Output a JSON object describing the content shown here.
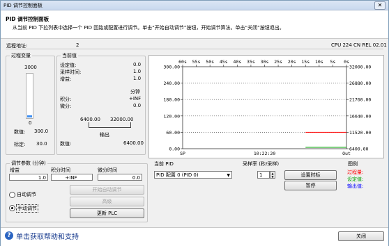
{
  "window": {
    "title": "PID 调节控制面板",
    "close_glyph": "✕"
  },
  "header": {
    "title": "PID 调节控制面板",
    "description": "从当前 PID 下拉列表中选择一个 PID 回路或配置进行调节。单击“开始自动调节”按钮，开始调节算法。单击“关闭”按钮退出。"
  },
  "info_bar": {
    "remote_label": "远程地址:",
    "remote_value": "2",
    "cpu_label": "CPU 224 CN REL 02.01"
  },
  "process_variable": {
    "group_label": "过程变量",
    "scale_top": "3000",
    "scale_bottom": "0",
    "bar_level": 0.05,
    "value_label": "数值:",
    "value": "300.0",
    "setpoint_label": "标定:",
    "setpoint": "30.0"
  },
  "current_values": {
    "group_label": "当前值",
    "rows": [
      {
        "label": "设定值:",
        "value": "0.0"
      },
      {
        "label": "采样时间:",
        "value": "1.0"
      },
      {
        "label": "增益:",
        "value": "1.0"
      }
    ],
    "minutes_label": "分钟",
    "integral_label": "积分:",
    "integral_value": "+INF",
    "derivative_label": "微分:",
    "derivative_value": "0.0",
    "output_min": "6400.00",
    "output_max": "32000.00",
    "output_label": "输出",
    "output_value_label": "数值:",
    "output_value": "6400.00"
  },
  "chart_data": {
    "type": "line",
    "x_ticks": [
      "60s",
      "55s",
      "50s",
      "45s",
      "40s",
      "35s",
      "30s",
      "25s",
      "20s",
      "15s",
      "10s",
      "5s",
      "0s"
    ],
    "left_ticks": [
      "300.00",
      "240.00",
      "180.00",
      "120.00",
      "60.00",
      "0.00"
    ],
    "right_ticks": [
      "32000.00",
      "26880.00",
      "21760.00",
      "16640.00",
      "11520.00",
      "6400.00"
    ],
    "bottom_left_label": "SP",
    "bottom_center_label": "10:22:20",
    "bottom_right_label": "Out",
    "left_range": [
      0,
      300
    ],
    "right_range": [
      6400,
      32000
    ],
    "grid": true,
    "series": [
      {
        "name": "过程量",
        "color": "#ff0000",
        "x": [
          15,
          0
        ],
        "y": [
          60,
          60
        ]
      },
      {
        "name": "输出值",
        "color": "#00a000",
        "x": [
          15,
          0
        ],
        "y": [
          0,
          0
        ]
      }
    ]
  },
  "tuning": {
    "group_label": "调节参数 (分钟)",
    "gain_label": "增益",
    "gain_value": "1.0",
    "integral_label": "积分时间",
    "integral_value": "+INF",
    "derivative_label": "微分时间",
    "derivative_value": "0.0",
    "auto_label": "自动调节",
    "manual_label": "手动调节",
    "start_auto_button": "开始自动调节",
    "advanced_button": "高级",
    "update_button": "更新 PLC"
  },
  "current_pid": {
    "label": "当前 PID",
    "selected": "PID 配置 0 (PID 0)"
  },
  "sample_rate": {
    "label": "采样率 (秒/采样)",
    "value": "1",
    "set_button": "设置时标",
    "pause_button": "暂停"
  },
  "legend": {
    "label": "图例",
    "items": [
      {
        "text": "过程量:",
        "color": "#ff0000"
      },
      {
        "text": "设定值:",
        "color": "#00a000"
      },
      {
        "text": "输出值:",
        "color": "#0000ff"
      }
    ]
  },
  "footer": {
    "help_text": "单击获取帮助和支持",
    "close_button": "关闭"
  }
}
